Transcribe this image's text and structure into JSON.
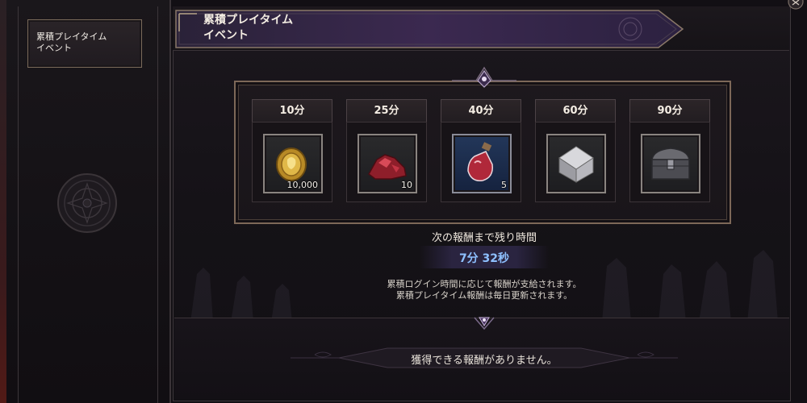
{
  "sidebar": {
    "item_label": "累積プレイタイム\nイベント"
  },
  "header": {
    "title": "累積プレイタイム\nイベント"
  },
  "rewards": [
    {
      "time": "10分",
      "item": "gold-coin-icon",
      "qty": "10,000",
      "bg": "gray"
    },
    {
      "time": "25分",
      "item": "red-ore-icon",
      "qty": "10",
      "bg": "gray"
    },
    {
      "time": "40分",
      "item": "potion-icon",
      "qty": "5",
      "bg": "blue"
    },
    {
      "time": "60分",
      "item": "silver-cube-icon",
      "qty": "",
      "bg": "gray"
    },
    {
      "time": "90分",
      "item": "chest-icon",
      "qty": "",
      "bg": "gray"
    }
  ],
  "countdown": {
    "label": "次の報酬まで残り時間",
    "value": "7分 32秒"
  },
  "info": "累積ログイン時間に応じて報酬が支給されます。\n累積プレイタイム報酬は毎日更新されます。",
  "footer": {
    "no_reward_text": "獲得できる報酬がありません。"
  },
  "colors": {
    "accent_purple": "#3b2950",
    "timer_blue": "#8ec0ff",
    "frame_gold": "#7d6858"
  }
}
